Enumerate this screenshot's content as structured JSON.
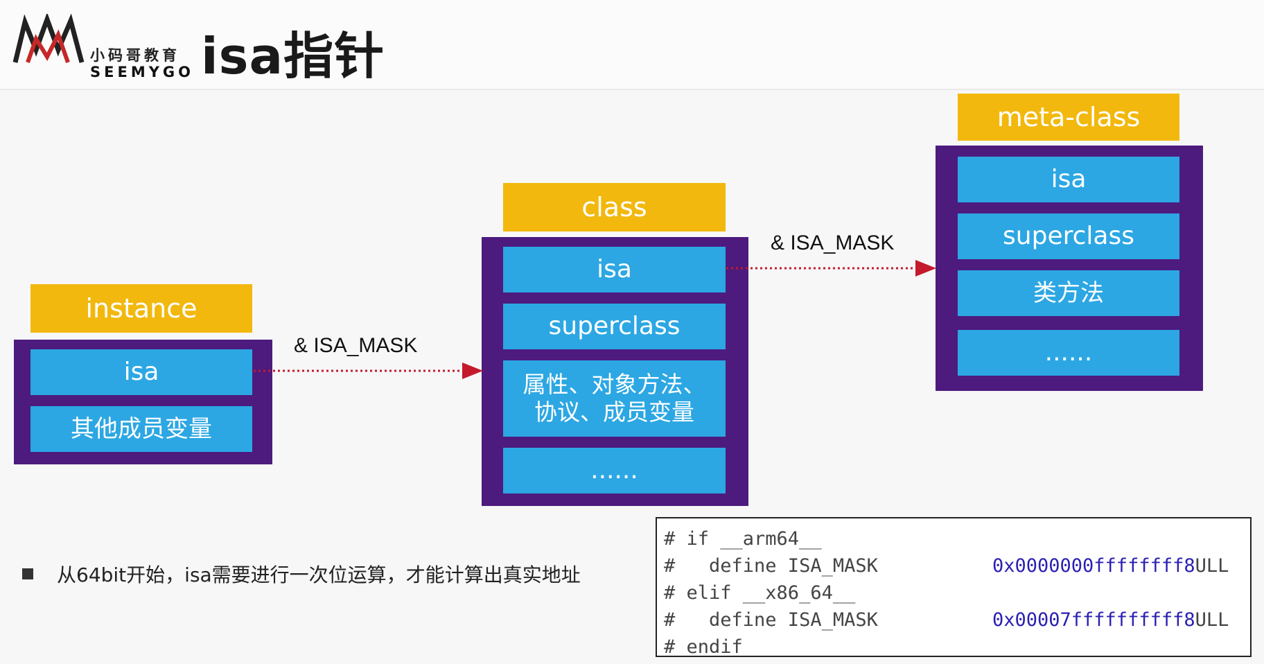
{
  "header": {
    "logo_cn": "小码哥教育",
    "logo_en": "SEEMYGO",
    "title": "isa指针"
  },
  "instance": {
    "title": "instance",
    "cells": [
      "isa",
      "其他成员变量"
    ]
  },
  "class": {
    "title": "class",
    "cells": [
      "isa",
      "superclass",
      "属性、对象方法、\n协议、成员变量",
      "......"
    ]
  },
  "meta_class": {
    "title": "meta-class",
    "cells": [
      "isa",
      "superclass",
      "类方法",
      "......"
    ]
  },
  "arrows": {
    "instance_to_class": "& ISA_MASK",
    "class_to_meta": "& ISA_MASK"
  },
  "note": "从64bit开始，isa需要进行一次位运算，才能计算出真实地址",
  "code": {
    "lines": [
      "# if __arm64__",
      "#   define ISA_MASK",
      "# elif __x86_64__",
      "#   define ISA_MASK",
      "# endif"
    ],
    "values": [
      {
        "hex": "0x0000000ffffffff8",
        "suffix": "ULL"
      },
      {
        "hex": "0x00007ffffffffff8",
        "suffix": "ULL"
      }
    ]
  },
  "colors": {
    "title_bar": "#f2b80e",
    "frame": "#4d1a7e",
    "cell": "#2ca7e3",
    "arrow": "#c41a2c",
    "hex_value": "#2a1fb3"
  }
}
